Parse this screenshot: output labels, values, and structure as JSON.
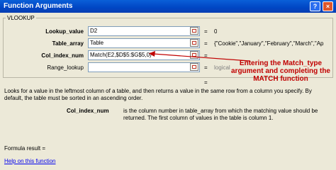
{
  "window": {
    "title": "Function Arguments",
    "help_button": "?",
    "close_button": "×"
  },
  "group": {
    "label": "VLOOKUP"
  },
  "arguments": [
    {
      "label": "Lookup_value",
      "value": "D2",
      "eq": "=",
      "result": "0"
    },
    {
      "label": "Table_array",
      "value": "Table",
      "eq": "=",
      "result": "{\"Cookie\",\"January\",\"February\",\"March\",\"Ap"
    },
    {
      "label": "Col_index_num",
      "value": "Match(E2,$D$5:$G$5,0)",
      "eq": "=",
      "result": ""
    },
    {
      "label": "Range_lookup",
      "value": "",
      "eq": "=",
      "result": "logical"
    }
  ],
  "result_eq": "=",
  "annotation": "Entering the Match_type argument and completing the MATCH function",
  "description": "Looks for a value in the leftmost column of a table, and then returns a value in the same row from a column you specify. By default, the table must be sorted in an ascending order.",
  "arg_description": {
    "name": "Col_index_num",
    "text": "is the column number in table_array from which the matching value should be returned. The first column of values in the table is column 1."
  },
  "formula_result": "Formula result =",
  "help_link": "Help on this function",
  "colors": {
    "title_bar": "#0046c4",
    "annotation": "#c00000",
    "dialog_bg": "#ece9d8"
  }
}
